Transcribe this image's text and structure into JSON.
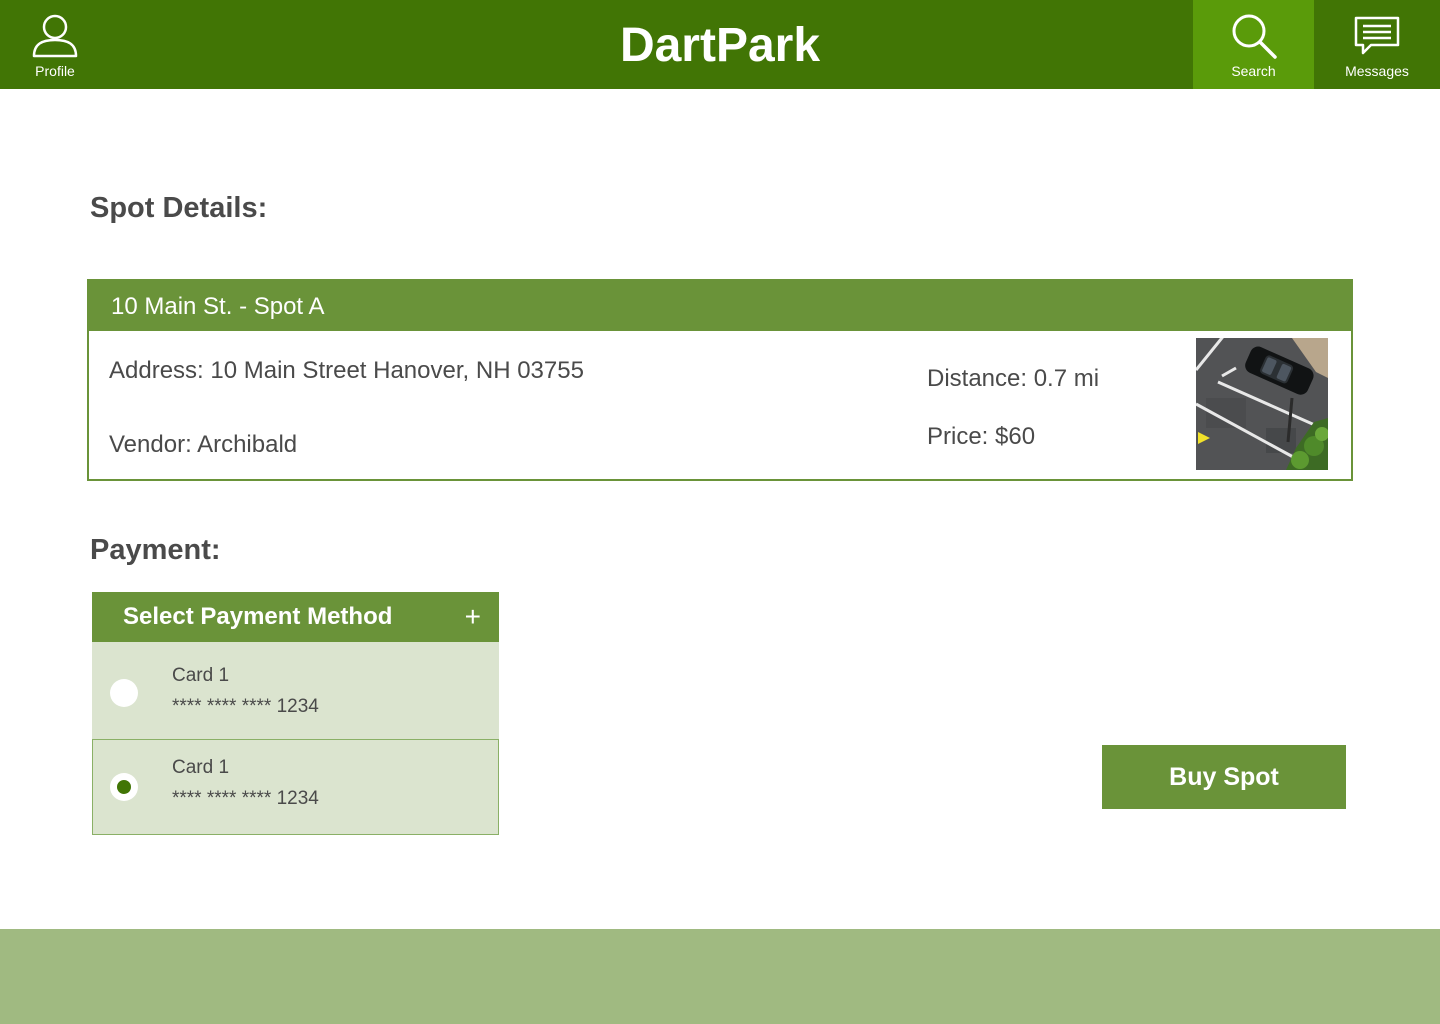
{
  "app": {
    "title": "DartPark",
    "nav": {
      "profile_label": "Profile",
      "search_label": "Search",
      "messages_label": "Messages",
      "active": "Search"
    }
  },
  "spot_section": {
    "heading": "Spot Details:",
    "spot": {
      "title": "10 Main St. - Spot A",
      "address": "Address: 10 Main Street Hanover, NH 03755",
      "vendor": "Vendor: Archibald",
      "distance": "Distance: 0.7 mi",
      "price": "Price: $60",
      "photo_icon": "parking-lot-photo"
    }
  },
  "payment_section": {
    "heading": "Payment:",
    "panel_title": "Select Payment Method",
    "add_icon": "+",
    "cards": [
      {
        "name": "Card 1",
        "number": "**** **** **** 1234",
        "selected": false
      },
      {
        "name": "Card 1",
        "number": "**** **** **** 1234",
        "selected": true
      }
    ]
  },
  "actions": {
    "buy_label": "Buy Spot"
  },
  "colors": {
    "header_green": "#417505",
    "active_tab_green": "#5a9b0a",
    "accent_green": "#6a9339",
    "card_bg": "#dbe4cf",
    "footer_green": "#a0ba81"
  }
}
